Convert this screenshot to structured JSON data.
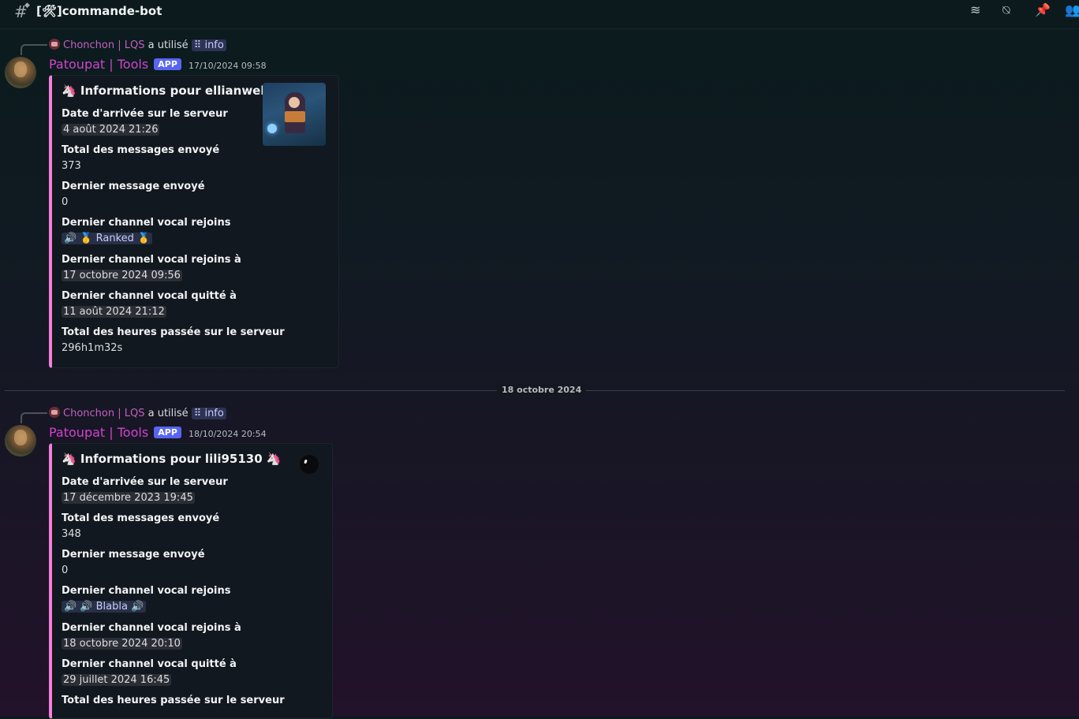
{
  "channel": {
    "name": "[🛠]commande-bot"
  },
  "date_divider": "18 octobre 2024",
  "messages": [
    {
      "reply": {
        "user": "Chonchon | LQS",
        "action": "a utilisé",
        "command": "⠿ info"
      },
      "author": "Patoupat | Tools",
      "tag": "APP",
      "timestamp": "17/10/2024 09:58",
      "embed": {
        "title": "🦄 Informations pour ellianwell 🦄",
        "fields": [
          {
            "name": "Date d'arrivée sur le serveur",
            "value": "4 août 2024 21:26"
          },
          {
            "name": "Total des messages envoyé",
            "value": "373"
          },
          {
            "name": "Dernier message envoyé",
            "value": "0"
          },
          {
            "name": "Dernier channel vocal rejoins",
            "value": "🔊 🥇 Ranked 🥇"
          },
          {
            "name": "Dernier channel vocal rejoins à",
            "value": "17 octobre 2024 09:56"
          },
          {
            "name": "Dernier channel vocal quitté à",
            "value": "11 août 2024 21:12"
          },
          {
            "name": "Total des heures passée sur le serveur",
            "value": "296h1m32s"
          }
        ]
      }
    },
    {
      "reply": {
        "user": "Chonchon | LQS",
        "action": "a utilisé",
        "command": "⠿ info"
      },
      "author": "Patoupat | Tools",
      "tag": "APP",
      "timestamp": "18/10/2024 20:54",
      "embed": {
        "title": "🦄 Informations pour lili95130 🦄",
        "fields": [
          {
            "name": "Date d'arrivée sur le serveur",
            "value": "17 décembre 2023 19:45"
          },
          {
            "name": "Total des messages envoyé",
            "value": "348"
          },
          {
            "name": "Dernier message envoyé",
            "value": "0"
          },
          {
            "name": "Dernier channel vocal rejoins",
            "value": "🔊 🔊 Blabla 🔊"
          },
          {
            "name": "Dernier channel vocal rejoins à",
            "value": "18 octobre 2024 20:10"
          },
          {
            "name": "Dernier channel vocal quitté à",
            "value": "29 juillet 2024 16:45"
          },
          {
            "name": "Total des heures passée sur le serveur",
            "value": ""
          }
        ]
      }
    }
  ],
  "icons": [
    "hashtag-icon",
    "threads-icon",
    "mute-icon",
    "pin-icon",
    "members-icon"
  ]
}
